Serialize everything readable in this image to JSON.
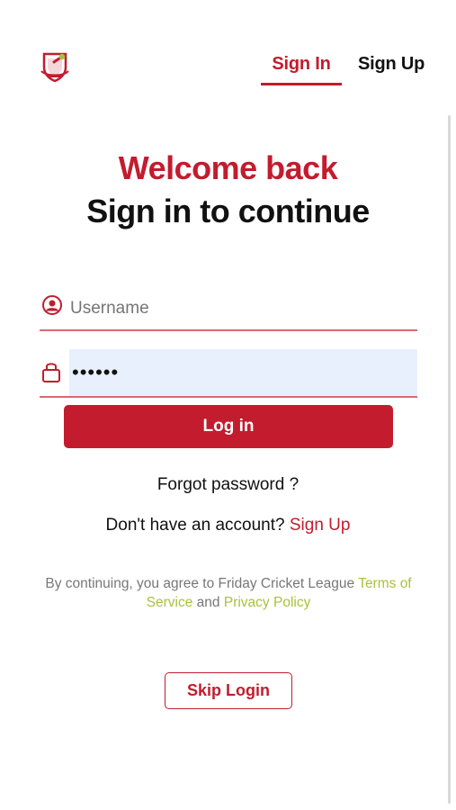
{
  "header": {
    "logo_icon": "cricket-shield-logo",
    "tabs": [
      {
        "label": "Sign In",
        "active": true
      },
      {
        "label": "Sign Up",
        "active": false
      }
    ]
  },
  "hero": {
    "welcome": "Welcome back",
    "subtitle": "Sign in to continue"
  },
  "form": {
    "username": {
      "icon": "user-circle-icon",
      "placeholder": "Username",
      "value": ""
    },
    "password": {
      "icon": "lock-icon",
      "placeholder": "",
      "value": "••••••"
    },
    "login_label": "Log in"
  },
  "links": {
    "forgot": "Forgot password ?",
    "no_account": "Don't have an account?",
    "signup": "Sign Up"
  },
  "terms": {
    "prefix": "By continuing, you agree to Friday Cricket League",
    "terms_link": "Terms of Service",
    "and": "and",
    "privacy_link": "Privacy Policy"
  },
  "skip_label": "Skip Login",
  "colors": {
    "brand_red": "#c21c2e",
    "link_green": "#a8c23a",
    "autofill_blue": "#e8f0fe"
  }
}
